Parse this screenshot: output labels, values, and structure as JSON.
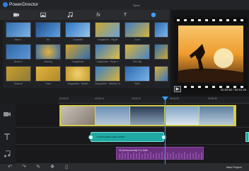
{
  "app": {
    "title": "PowerDirector"
  },
  "library": {
    "heading": "Sport",
    "tabs": [
      {
        "icon": "video-icon"
      },
      {
        "icon": "image-icon"
      },
      {
        "icon": "music-icon"
      },
      {
        "icon": "fx-icon",
        "label": "fx"
      },
      {
        "icon": "title-icon",
        "label": "T"
      },
      {
        "icon": "brush-icon"
      }
    ],
    "items": [
      {
        "label": "Blues 1"
      },
      {
        "label": "Blo"
      },
      {
        "label": "Crystallist"
      },
      {
        "label": "Gargantube - Ripple"
      },
      {
        "label": "Scott"
      },
      {
        "label": ""
      },
      {
        "label": "Brown 2"
      },
      {
        "label": "Burning"
      },
      {
        "label": "Gargantube"
      },
      {
        "label": "Gargantube - Ripple 2"
      },
      {
        "label": "Film Clip"
      },
      {
        "label": ""
      },
      {
        "label": "Museoft"
      },
      {
        "label": "Fuzer"
      },
      {
        "label": "Gargantube - Bubble"
      },
      {
        "label": "Gargantube - Stacked Cross"
      },
      {
        "label": "Spite"
      },
      {
        "label": ""
      }
    ]
  },
  "preview": {
    "timecode": "00:00:50 / 00:01:46"
  },
  "timeline": {
    "ticks": [
      "00:00:00",
      "00:00:10",
      "00:00:20",
      "00:00:30",
      "00:00:40"
    ],
    "text_clip_label": "I mount game-play mover!",
    "audio_clip_label": "06 (Instrumental) For Matt.."
  },
  "bottom_bar": {
    "new_project": "New Project"
  },
  "colors": {
    "accent": "#3aa0ff",
    "video_border": "#d7d14f",
    "text_clip": "#1fa9a3",
    "audio_clip": "#6a2f7f"
  }
}
